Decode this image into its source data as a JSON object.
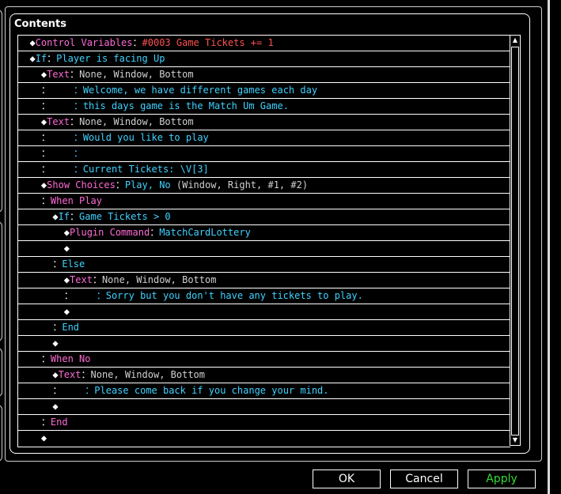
{
  "panel": {
    "title": "Contents"
  },
  "rows": [
    [
      [
        "◆",
        "d"
      ],
      [
        "Control Variables",
        "pink"
      ],
      [
        "：",
        "d"
      ],
      [
        "#0003 Game Tickets += 1",
        "red"
      ]
    ],
    [
      [
        "◆",
        "d"
      ],
      [
        "If",
        "cyan"
      ],
      [
        "：",
        "d"
      ],
      [
        "Player is facing Up",
        "cyan"
      ]
    ],
    [
      [
        "  ◆",
        "d"
      ],
      [
        "Text",
        "pink"
      ],
      [
        "：",
        "d"
      ],
      [
        "None, Window, Bottom",
        "gray"
      ]
    ],
    [
      [
        "  ：    ",
        "d"
      ],
      [
        "：",
        "cyan"
      ],
      [
        "Welcome, we have different games each day",
        "cyan"
      ]
    ],
    [
      [
        "  ：    ",
        "d"
      ],
      [
        "：",
        "cyan"
      ],
      [
        "this days game is the Match Um Game.",
        "cyan"
      ]
    ],
    [
      [
        "  ◆",
        "d"
      ],
      [
        "Text",
        "pink"
      ],
      [
        "：",
        "d"
      ],
      [
        "None, Window, Bottom",
        "gray"
      ]
    ],
    [
      [
        "  ：    ",
        "d"
      ],
      [
        "：",
        "cyan"
      ],
      [
        "Would you like to play",
        "cyan"
      ]
    ],
    [
      [
        "  ：    ",
        "d"
      ],
      [
        "：",
        "cyan"
      ]
    ],
    [
      [
        "  ：    ",
        "d"
      ],
      [
        "：",
        "cyan"
      ],
      [
        "Current Tickets: \\V[3]",
        "cyan"
      ]
    ],
    [
      [
        "  ◆",
        "d"
      ],
      [
        "Show Choices",
        "pink"
      ],
      [
        "：",
        "d"
      ],
      [
        "Play, No",
        "cyan"
      ],
      [
        " (Window, Right, #1, #2)",
        "gray"
      ]
    ],
    [
      [
        "  ：",
        "d"
      ],
      [
        "When Play",
        "pink"
      ]
    ],
    [
      [
        "    ◆",
        "d"
      ],
      [
        "If",
        "cyan"
      ],
      [
        "：",
        "d"
      ],
      [
        "Game Tickets > 0",
        "cyan"
      ]
    ],
    [
      [
        "      ◆",
        "d"
      ],
      [
        "Plugin Command",
        "pink"
      ],
      [
        "：",
        "d"
      ],
      [
        "MatchCardLottery",
        "cyan"
      ]
    ],
    [
      [
        "      ◆",
        "d"
      ]
    ],
    [
      [
        "    ：",
        "d"
      ],
      [
        "Else",
        "cyan"
      ]
    ],
    [
      [
        "      ◆",
        "d"
      ],
      [
        "Text",
        "pink"
      ],
      [
        "：",
        "d"
      ],
      [
        "None, Window, Bottom",
        "gray"
      ]
    ],
    [
      [
        "      ：    ",
        "d"
      ],
      [
        "：",
        "cyan"
      ],
      [
        "Sorry but you don't have any tickets to play.",
        "cyan"
      ]
    ],
    [
      [
        "      ◆",
        "d"
      ]
    ],
    [
      [
        "    ：",
        "d"
      ],
      [
        "End",
        "cyan"
      ]
    ],
    [
      [
        "    ◆",
        "d"
      ]
    ],
    [
      [
        "  ：",
        "d"
      ],
      [
        "When No",
        "pink"
      ]
    ],
    [
      [
        "    ◆",
        "d"
      ],
      [
        "Text",
        "pink"
      ],
      [
        "：",
        "d"
      ],
      [
        "None, Window, Bottom",
        "gray"
      ]
    ],
    [
      [
        "    ：    ",
        "d"
      ],
      [
        "：",
        "cyan"
      ],
      [
        "Please come back if you change your mind.",
        "cyan"
      ]
    ],
    [
      [
        "    ◆",
        "d"
      ]
    ],
    [
      [
        "  ：",
        "d"
      ],
      [
        "End",
        "pink"
      ]
    ],
    [
      [
        "  ◆",
        "d"
      ]
    ]
  ],
  "buttons": {
    "ok": "OK",
    "cancel": "Cancel",
    "apply": "Apply"
  },
  "colors": {
    "command": "#ff6ad5",
    "value": "#3fd2ff",
    "param": "#d0d0d0",
    "variable": "#ff5050",
    "apply": "#33dd33"
  },
  "icons": {
    "scroll_up": "triangle-up",
    "scroll_down": "triangle-down"
  }
}
